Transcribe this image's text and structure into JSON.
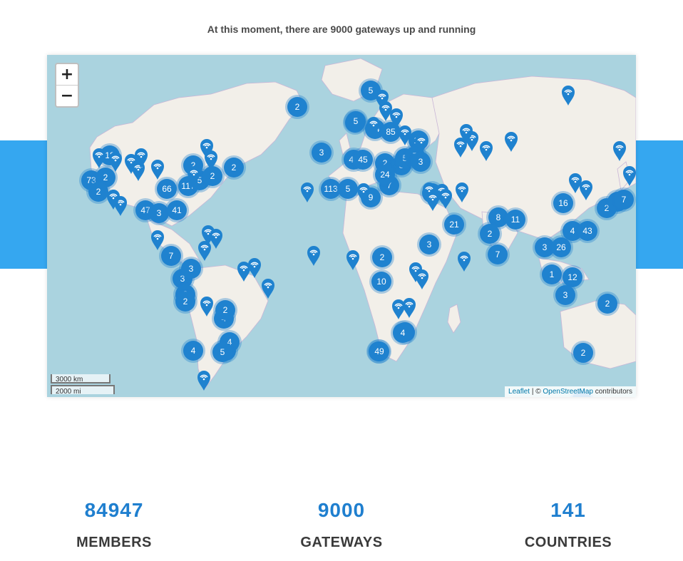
{
  "headline": "At this moment, there are 9000 gateways up and running",
  "map": {
    "zoom_in": "+",
    "zoom_out": "−",
    "scale_km": "3000 km",
    "scale_mi": "2000 mi",
    "attribution": {
      "leaflet": "Leaflet",
      "sep": " | © ",
      "osm": "OpenStreetMap",
      "suffix": " contributors"
    },
    "clusters": [
      "5",
      "2",
      "47",
      "45",
      "5",
      "54",
      "85",
      "10",
      "3",
      "113",
      "5",
      "9",
      "7",
      "2",
      "3",
      "2",
      "24",
      "5",
      "7",
      "3",
      "18",
      "73",
      "2",
      "2",
      "47",
      "3",
      "41",
      "66",
      "117",
      "5",
      "2",
      "2",
      "2",
      "7",
      "3",
      "2",
      "3",
      "2",
      "4",
      "2",
      "4",
      "5",
      "4",
      "2",
      "2",
      "10",
      "2",
      "2",
      "4",
      "49",
      "8",
      "11",
      "2",
      "7",
      "21",
      "3",
      "26",
      "4",
      "43",
      "16",
      "2",
      "8",
      "7",
      "1",
      "12",
      "3",
      "3",
      "2",
      "2",
      "2",
      "2"
    ],
    "colors": {
      "water": "#aad3df",
      "land": "#f2efe9",
      "cluster": "#1f82cf",
      "band": "#35a7f0"
    }
  },
  "stats": [
    {
      "value": "84947",
      "label": "MEMBERS"
    },
    {
      "value": "9000",
      "label": "GATEWAYS"
    },
    {
      "value": "141",
      "label": "COUNTRIES"
    }
  ]
}
